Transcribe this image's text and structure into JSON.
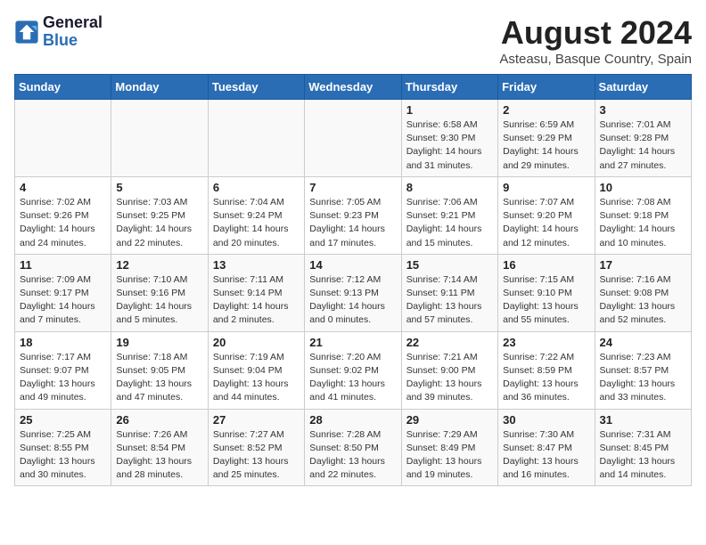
{
  "app": {
    "logo_line1": "General",
    "logo_line2": "Blue"
  },
  "header": {
    "month_year": "August 2024",
    "location": "Asteasu, Basque Country, Spain"
  },
  "weekdays": [
    "Sunday",
    "Monday",
    "Tuesday",
    "Wednesday",
    "Thursday",
    "Friday",
    "Saturday"
  ],
  "weeks": [
    [
      {
        "day": "",
        "info": ""
      },
      {
        "day": "",
        "info": ""
      },
      {
        "day": "",
        "info": ""
      },
      {
        "day": "",
        "info": ""
      },
      {
        "day": "1",
        "info": "Sunrise: 6:58 AM\nSunset: 9:30 PM\nDaylight: 14 hours\nand 31 minutes."
      },
      {
        "day": "2",
        "info": "Sunrise: 6:59 AM\nSunset: 9:29 PM\nDaylight: 14 hours\nand 29 minutes."
      },
      {
        "day": "3",
        "info": "Sunrise: 7:01 AM\nSunset: 9:28 PM\nDaylight: 14 hours\nand 27 minutes."
      }
    ],
    [
      {
        "day": "4",
        "info": "Sunrise: 7:02 AM\nSunset: 9:26 PM\nDaylight: 14 hours\nand 24 minutes."
      },
      {
        "day": "5",
        "info": "Sunrise: 7:03 AM\nSunset: 9:25 PM\nDaylight: 14 hours\nand 22 minutes."
      },
      {
        "day": "6",
        "info": "Sunrise: 7:04 AM\nSunset: 9:24 PM\nDaylight: 14 hours\nand 20 minutes."
      },
      {
        "day": "7",
        "info": "Sunrise: 7:05 AM\nSunset: 9:23 PM\nDaylight: 14 hours\nand 17 minutes."
      },
      {
        "day": "8",
        "info": "Sunrise: 7:06 AM\nSunset: 9:21 PM\nDaylight: 14 hours\nand 15 minutes."
      },
      {
        "day": "9",
        "info": "Sunrise: 7:07 AM\nSunset: 9:20 PM\nDaylight: 14 hours\nand 12 minutes."
      },
      {
        "day": "10",
        "info": "Sunrise: 7:08 AM\nSunset: 9:18 PM\nDaylight: 14 hours\nand 10 minutes."
      }
    ],
    [
      {
        "day": "11",
        "info": "Sunrise: 7:09 AM\nSunset: 9:17 PM\nDaylight: 14 hours\nand 7 minutes."
      },
      {
        "day": "12",
        "info": "Sunrise: 7:10 AM\nSunset: 9:16 PM\nDaylight: 14 hours\nand 5 minutes."
      },
      {
        "day": "13",
        "info": "Sunrise: 7:11 AM\nSunset: 9:14 PM\nDaylight: 14 hours\nand 2 minutes."
      },
      {
        "day": "14",
        "info": "Sunrise: 7:12 AM\nSunset: 9:13 PM\nDaylight: 14 hours\nand 0 minutes."
      },
      {
        "day": "15",
        "info": "Sunrise: 7:14 AM\nSunset: 9:11 PM\nDaylight: 13 hours\nand 57 minutes."
      },
      {
        "day": "16",
        "info": "Sunrise: 7:15 AM\nSunset: 9:10 PM\nDaylight: 13 hours\nand 55 minutes."
      },
      {
        "day": "17",
        "info": "Sunrise: 7:16 AM\nSunset: 9:08 PM\nDaylight: 13 hours\nand 52 minutes."
      }
    ],
    [
      {
        "day": "18",
        "info": "Sunrise: 7:17 AM\nSunset: 9:07 PM\nDaylight: 13 hours\nand 49 minutes."
      },
      {
        "day": "19",
        "info": "Sunrise: 7:18 AM\nSunset: 9:05 PM\nDaylight: 13 hours\nand 47 minutes."
      },
      {
        "day": "20",
        "info": "Sunrise: 7:19 AM\nSunset: 9:04 PM\nDaylight: 13 hours\nand 44 minutes."
      },
      {
        "day": "21",
        "info": "Sunrise: 7:20 AM\nSunset: 9:02 PM\nDaylight: 13 hours\nand 41 minutes."
      },
      {
        "day": "22",
        "info": "Sunrise: 7:21 AM\nSunset: 9:00 PM\nDaylight: 13 hours\nand 39 minutes."
      },
      {
        "day": "23",
        "info": "Sunrise: 7:22 AM\nSunset: 8:59 PM\nDaylight: 13 hours\nand 36 minutes."
      },
      {
        "day": "24",
        "info": "Sunrise: 7:23 AM\nSunset: 8:57 PM\nDaylight: 13 hours\nand 33 minutes."
      }
    ],
    [
      {
        "day": "25",
        "info": "Sunrise: 7:25 AM\nSunset: 8:55 PM\nDaylight: 13 hours\nand 30 minutes."
      },
      {
        "day": "26",
        "info": "Sunrise: 7:26 AM\nSunset: 8:54 PM\nDaylight: 13 hours\nand 28 minutes."
      },
      {
        "day": "27",
        "info": "Sunrise: 7:27 AM\nSunset: 8:52 PM\nDaylight: 13 hours\nand 25 minutes."
      },
      {
        "day": "28",
        "info": "Sunrise: 7:28 AM\nSunset: 8:50 PM\nDaylight: 13 hours\nand 22 minutes."
      },
      {
        "day": "29",
        "info": "Sunrise: 7:29 AM\nSunset: 8:49 PM\nDaylight: 13 hours\nand 19 minutes."
      },
      {
        "day": "30",
        "info": "Sunrise: 7:30 AM\nSunset: 8:47 PM\nDaylight: 13 hours\nand 16 minutes."
      },
      {
        "day": "31",
        "info": "Sunrise: 7:31 AM\nSunset: 8:45 PM\nDaylight: 13 hours\nand 14 minutes."
      }
    ]
  ]
}
